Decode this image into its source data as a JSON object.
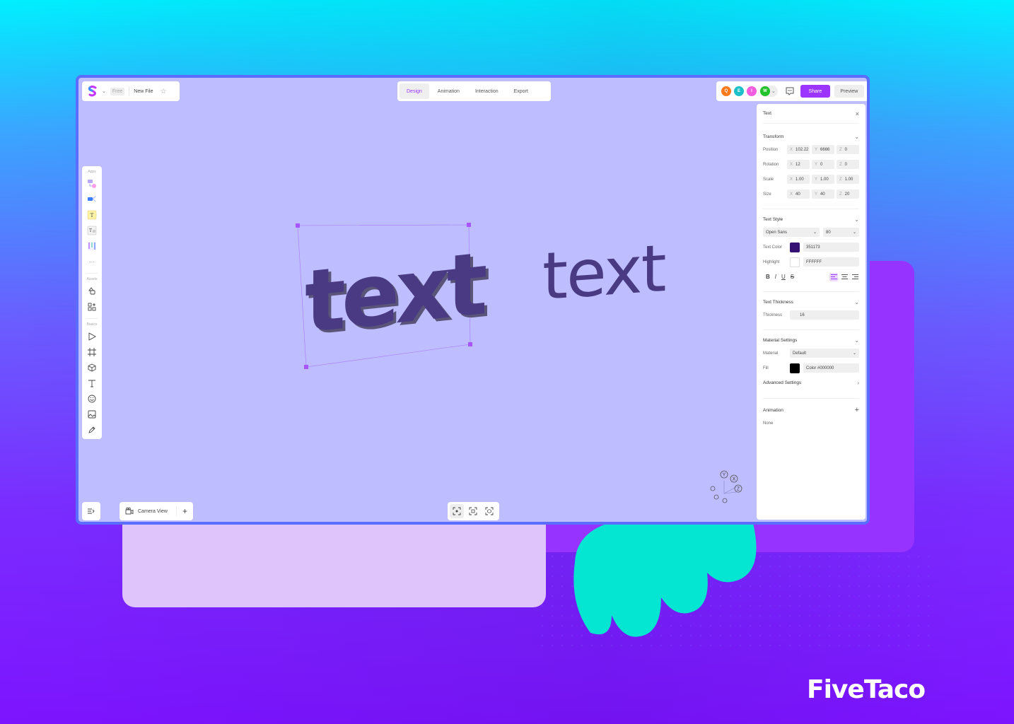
{
  "header": {
    "plan_badge": "Free",
    "file_name": "New File",
    "tabs": [
      {
        "label": "Design",
        "active": true
      },
      {
        "label": "Animation",
        "active": false
      },
      {
        "label": "Interaction",
        "active": false
      },
      {
        "label": "Export",
        "active": false
      }
    ],
    "collaborators": [
      {
        "initial": "Q",
        "color": "#ff7a1a"
      },
      {
        "initial": "E",
        "color": "#1bc0c8"
      },
      {
        "initial": "I",
        "color": "#f25ce0"
      },
      {
        "initial": "W",
        "color": "#22c22a"
      }
    ],
    "share_label": "Share",
    "preview_label": "Preview"
  },
  "toolbar": {
    "apps_label": "Apps",
    "assets_label": "Assets",
    "basics_label": "Basics",
    "more_label": "···"
  },
  "canvas": {
    "text_3d": "text",
    "text_flat": "text",
    "axis_labels": [
      "Y",
      "X",
      "Z"
    ]
  },
  "bottom": {
    "camera_label": "Camera View"
  },
  "panel": {
    "title": "Text",
    "transform": {
      "title": "Transform",
      "rows": [
        {
          "label": "Position",
          "x": "102.22",
          "y": "6666",
          "z": "0"
        },
        {
          "label": "Rotation",
          "x": "12",
          "y": "0",
          "z": "0"
        },
        {
          "label": "Scale",
          "x": "1.00",
          "y": "1.00",
          "z": "1.00"
        },
        {
          "label": "Size",
          "x": "40",
          "y": "40",
          "z": "20"
        }
      ]
    },
    "text_style": {
      "title": "Text Style",
      "font": "Open Sans",
      "size": "80",
      "text_color_label": "Text Color",
      "text_color": "351173",
      "text_color_hex": "#351173",
      "highlight_label": "Highlight",
      "highlight": "FFFFFF",
      "highlight_hex": "#FFFFFF",
      "bold": "B",
      "italic": "I",
      "underline": "U",
      "strike": "S"
    },
    "thickness": {
      "title": "Text Thickness",
      "label": "Thickness",
      "value": "16"
    },
    "material": {
      "title": "Material Settings",
      "material_label": "Material",
      "material_value": "Default",
      "fill_label": "Fill",
      "fill_value": "Color #000000",
      "fill_hex": "#000000",
      "advanced_label": "Advanced Settings"
    },
    "animation": {
      "title": "Animation",
      "value": "None"
    }
  },
  "brand": {
    "name": "FiveTaco"
  },
  "colors": {
    "accent": "#9b35ff",
    "canvas_bg": "#bdbdff",
    "window_border": "#5a6dff",
    "text_3d": "#4a3a84",
    "teal_shape": "#05e6d2"
  }
}
